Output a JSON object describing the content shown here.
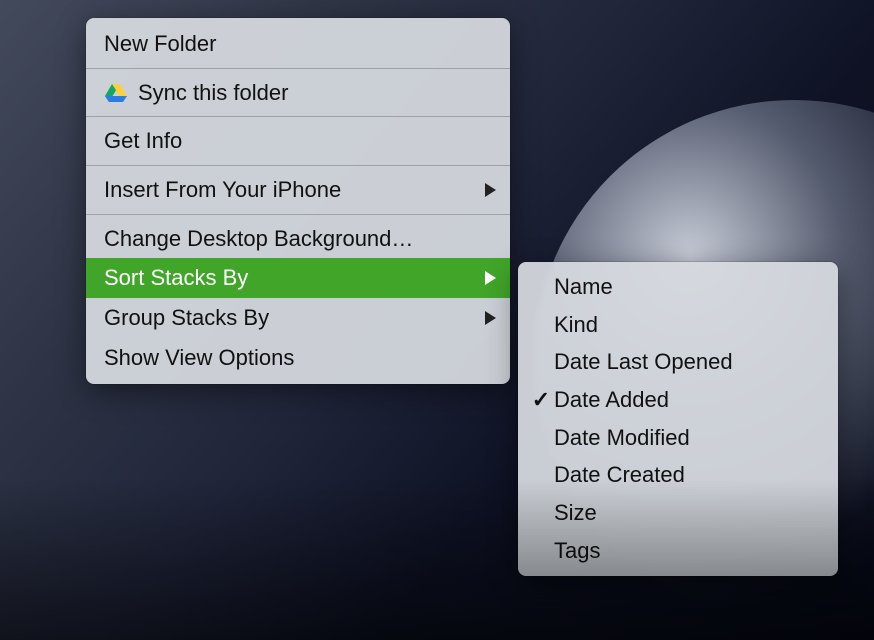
{
  "context_menu": {
    "items": [
      {
        "label": "New Folder"
      },
      {
        "label": "Sync this folder",
        "icon": "google-drive-icon"
      },
      {
        "label": "Get Info"
      },
      {
        "label": "Insert From Your iPhone",
        "has_submenu": true
      },
      {
        "label": "Change Desktop Background…"
      },
      {
        "label": "Sort Stacks By",
        "has_submenu": true,
        "highlighted": true
      },
      {
        "label": "Group Stacks By",
        "has_submenu": true
      },
      {
        "label": "Show View Options"
      }
    ]
  },
  "submenu_sort_stacks_by": {
    "items": [
      {
        "label": "Name",
        "checked": false
      },
      {
        "label": "Kind",
        "checked": false
      },
      {
        "label": "Date Last Opened",
        "checked": false
      },
      {
        "label": "Date Added",
        "checked": true
      },
      {
        "label": "Date Modified",
        "checked": false
      },
      {
        "label": "Date Created",
        "checked": false
      },
      {
        "label": "Size",
        "checked": false
      },
      {
        "label": "Tags",
        "checked": false
      }
    ]
  },
  "checkmark_glyph": "✓"
}
